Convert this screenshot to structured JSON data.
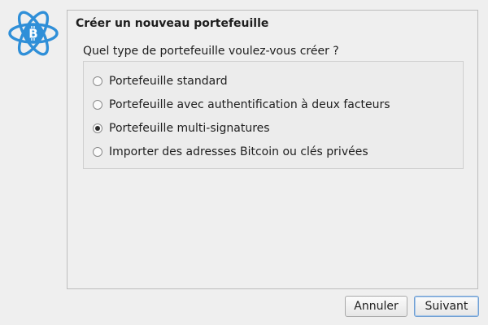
{
  "logo": {
    "icon": "electrum-bitcoin-atom-icon",
    "color": "#2f8fd8"
  },
  "panel": {
    "title": "Créer un nouveau portefeuille",
    "question": "Quel type de portefeuille voulez-vous créer ?",
    "options": [
      {
        "label": "Portefeuille standard",
        "checked": false
      },
      {
        "label": "Portefeuille avec authentification à deux facteurs",
        "checked": false
      },
      {
        "label": "Portefeuille multi-signatures",
        "checked": true
      },
      {
        "label": "Importer des adresses Bitcoin ou clés privées",
        "checked": false
      }
    ]
  },
  "buttons": {
    "cancel_label": "Annuler",
    "next_label": "Suivant"
  }
}
